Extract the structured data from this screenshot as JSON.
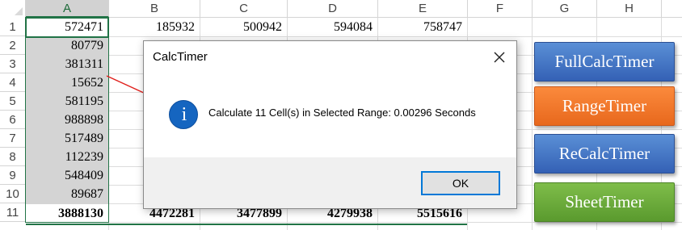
{
  "columns": [
    "A",
    "B",
    "C",
    "D",
    "E",
    "F",
    "G",
    "H"
  ],
  "rows": [
    "1",
    "2",
    "3",
    "4",
    "5",
    "6",
    "7",
    "8",
    "9",
    "10",
    "11"
  ],
  "row1": [
    "572471",
    "185932",
    "500942",
    "594084",
    "758747"
  ],
  "colA": [
    "80779",
    "381311",
    "15652",
    "581195",
    "988898",
    "517489",
    "112239",
    "548409",
    "89687"
  ],
  "row11": [
    "3888130",
    "4472281",
    "3477899",
    "4279938",
    "5515616"
  ],
  "dialog": {
    "title": "CalcTimer",
    "message": "Calculate 11 Cell(s) in Selected Range:  0.00296 Seconds",
    "ok_label": "OK",
    "icon": "info-icon"
  },
  "macros": [
    "FullCalcTimer",
    "RangeTimer",
    "ReCalcTimer",
    "SheetTimer"
  ],
  "colors": {
    "selection_green": "#217346",
    "button_blue": "#3f72c4",
    "button_orange": "#f07828",
    "button_green": "#6aaa3a",
    "arrow_red": "#e0201c",
    "info_blue": "#1565c0"
  }
}
